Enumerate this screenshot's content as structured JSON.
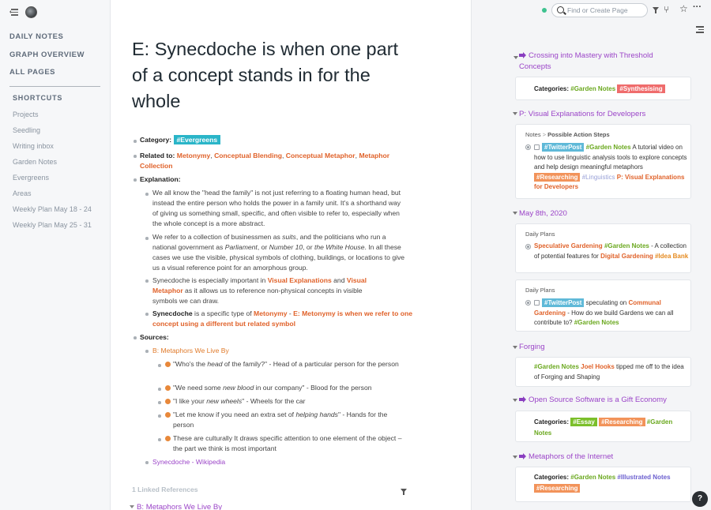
{
  "sidebar": {
    "nav": [
      "DAILY NOTES",
      "GRAPH OVERVIEW",
      "ALL PAGES"
    ],
    "shortcuts_title": "SHORTCUTS",
    "shortcuts": [
      "Projects",
      "Seedling",
      "Writing inbox",
      "Garden Notes",
      "Evergreens",
      "Areas",
      "Weekly Plan May 18 - 24",
      "Weekly Plan May 25 - 31"
    ]
  },
  "topbar": {
    "search_placeholder": "Find or Create Page",
    "status": "synced"
  },
  "page": {
    "title": "E: Synecdoche is when one part of a concept stands in for the whole",
    "category_label": "Category:",
    "category_tag": "#Evergreens",
    "related_label": "Related to:",
    "related_links": [
      "Metonymy",
      "Conceptual Blending",
      "Conceptual Metaphor",
      "Metaphor Collection"
    ],
    "explanation_label": "Explanation:",
    "explanation": {
      "p1": "We all know the \"head the family\" is not just referring to a floating human head, but instead the entire person who holds the power in a family unit. It's a shorthand way of giving us something small, specific, and often visible to refer to, especially when the whole concept is a more abstract.",
      "p2_a": "We refer to a collection of businessmen as ",
      "p2_suits": "suits",
      "p2_b": ", and the politicians who run a national government as ",
      "p2_parliament": "Parliament",
      "p2_c": ", or ",
      "p2_number10": "Number 10",
      "p2_d": ", or ",
      "p2_whitehouse": "the White House",
      "p2_e": ". In all these cases we use the visible, physical symbols of clothing, buildings, or locations to give us a visual reference point for an amorphous group.",
      "p3_a": "Synecdoche is especially important in ",
      "p3_link1": "Visual Explanations",
      "p3_b": " and ",
      "p3_link2": "Visual Metaphor",
      "p3_c": " as it allows us to reference non-physical concepts in visible symbols we can draw.",
      "p4_a": "Synecdoche",
      "p4_b": " is a specific type of ",
      "p4_link1": "Metonymy",
      "p4_sep": " - ",
      "p4_link2": "E: Metonymy is when we refer to one concept using a different but related symbol"
    },
    "sources_label": "Sources:",
    "source1": "B: Metaphors We Live By",
    "source_items": [
      {
        "a": "\"Who's the ",
        "i": "head",
        "b": " of the family?\" - Head of a particular person for the person"
      },
      {
        "a": "\"We need some ",
        "i": "new blood",
        "b": " in our company\" - Blood for the person"
      },
      {
        "a": "\"I like your ",
        "i": "new wheels",
        "b": "\" - Wheels for the car"
      },
      {
        "a": "\"Let me know if you need an extra set of ",
        "i": "helping hands",
        "b": "\" - Hands for the person"
      },
      {
        "a": "These are culturally It draws specific attention to one element of the object – the part we think is most important",
        "i": "",
        "b": ""
      }
    ],
    "source2": "Synecdoche - Wikipedia",
    "linked_refs": "1 Linked References",
    "linked_ref_item": "B: Metaphors We Live By"
  },
  "right_panel": {
    "sections": [
      {
        "title": "Crossing into Mastery with Threshold Concepts",
        "arrow": true
      },
      {
        "title": "P: Visual Explanations for Developers",
        "arrow": false
      },
      {
        "title": "May 8th, 2020",
        "arrow": false
      },
      {
        "title": "Forging",
        "arrow": false
      },
      {
        "title": "Open Source Software is a Gift Economy",
        "arrow": true
      },
      {
        "title": "Metaphors of the Internet",
        "arrow": true
      }
    ],
    "card1": {
      "label": "Categories:",
      "tag1": "#Garden Notes",
      "tag2": "#Synthesising"
    },
    "card2": {
      "bc1": "Notes",
      "bc_sep": ">",
      "bc2": "Possible Action Steps",
      "tag_twitter": "#TwitterPost",
      "tag_garden": "#Garden Notes",
      "text": " A tutorial video on how to use linguistic analysis tools to explore concepts and help design meaningful metaphors ",
      "tag_research": "#Researching",
      "tag_ling": "#Linguistics",
      "link": "P: Visual Explanations for Developers"
    },
    "card3": {
      "bc": "Daily Plans",
      "link1": "Speculative Gardening",
      "tag_garden": "#Garden Notes",
      "text": " - A collection of potential features for ",
      "link2": "Digital Gardening",
      "tag_idea": "#Idea Bank"
    },
    "card4": {
      "bc": "Daily Plans",
      "tag_twitter": "#TwitterPost",
      "text1": " speculating on ",
      "link": "Communal Gardening",
      "text2": " - How do we build Gardens we can all contribute to? ",
      "tag_garden": "#Garden Notes"
    },
    "card5": {
      "tag_garden": "#Garden Notes",
      "person": "Joel Hooks",
      "text": " tipped me off to the idea of Forging and Shaping"
    },
    "card6": {
      "label": "Categories:",
      "tag1": "#Essay",
      "tag2": "#Researching",
      "tag3": "#Garden Notes"
    },
    "card7": {
      "label": "Categories:",
      "tag1": "#Garden Notes",
      "tag2": "#Illustrated Notes",
      "tag3": "#Researching"
    },
    "help": "?"
  }
}
